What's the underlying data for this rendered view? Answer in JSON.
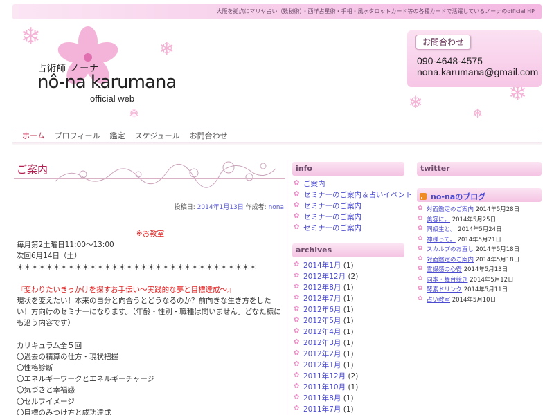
{
  "header": {
    "tagline": "大阪を拠点にマリヤ占い（数秘術）・西洋占星術・手相・風水タロットカード等の各種カードで活躍しているノーナのofficial HP",
    "logo_jp": "占術師 ノーナ",
    "logo_en": "nô-na karumana",
    "logo_sub": "official web"
  },
  "contact": {
    "button_label": "お問合わせ",
    "phone": "090-4648-4575",
    "email": "nona.karumana@gmail.com"
  },
  "nav": {
    "items": [
      "ホーム",
      "プロフィール",
      "鑑定",
      "スケジュール",
      "お問合わせ"
    ]
  },
  "article": {
    "title": "ご案内",
    "meta_prefix": "投稿日:",
    "meta_date": "2014年1月13日",
    "meta_author_label": "作成者:",
    "meta_author": "nona",
    "heading": "※お教室",
    "schedule_1": "毎月第2土曜日11:00～13:00",
    "schedule_2": "次回6月14日（土）",
    "stars": "＊＊＊＊＊＊＊＊＊＊＊＊＊＊＊＊＊＊＊＊＊＊＊＊＊＊＊＊＊＊＊＊＊",
    "catch": "『変わりたいきっかけを探すお手伝い～実践的な夢と目標達成～』",
    "desc": "現状を変えたい！本来の自分と向合うとどうなるのか？前向きな生き方をしたい！方向けのセミナーになります。（年齢・性別・職種は問いません。どなた様にも沿う内容です）",
    "curriculum_title": "カリキュラム全５回",
    "curriculum": [
      "〇過去の精算の仕方・現状把握",
      "〇性格診断",
      "〇エネルギーワークとエネルギーチャージ",
      "〇気づきと幸福感",
      "〇セルフイメージ",
      "〇目標のみつけ方と成功達成"
    ]
  },
  "info": {
    "title": "info",
    "items": [
      "ご案内",
      "セミナーのご案内＆占いイベント",
      "セミナーのご案内",
      "セミナーのご案内",
      "セミナーのご案内"
    ]
  },
  "archives": {
    "title": "archives",
    "items": [
      {
        "label": "2014年1月",
        "count": "(1)"
      },
      {
        "label": "2012年12月",
        "count": "(2)"
      },
      {
        "label": "2012年8月",
        "count": "(1)"
      },
      {
        "label": "2012年7月",
        "count": "(1)"
      },
      {
        "label": "2012年6月",
        "count": "(1)"
      },
      {
        "label": "2012年5月",
        "count": "(1)"
      },
      {
        "label": "2012年4月",
        "count": "(1)"
      },
      {
        "label": "2012年3月",
        "count": "(1)"
      },
      {
        "label": "2012年2月",
        "count": "(1)"
      },
      {
        "label": "2012年1月",
        "count": "(1)"
      },
      {
        "label": "2011年12月",
        "count": "(2)"
      },
      {
        "label": "2011年10月",
        "count": "(1)"
      },
      {
        "label": "2011年8月",
        "count": "(1)"
      },
      {
        "label": "2011年7月",
        "count": "(1)"
      }
    ]
  },
  "twitter": {
    "title": "twitter"
  },
  "blog": {
    "title": "no-naのブログ",
    "items": [
      {
        "label": "対面鑑定のご案内",
        "date": "2014年5月28日"
      },
      {
        "label": "美容に。",
        "date": "2014年5月25日"
      },
      {
        "label": "同級生と。",
        "date": "2014年5月24日"
      },
      {
        "label": "神様って。",
        "date": "2014年5月21日"
      },
      {
        "label": "スカルプのお直し",
        "date": "2014年5月18日"
      },
      {
        "label": "対面鑑定のご案内",
        "date": "2014年5月18日"
      },
      {
        "label": "霊媒感の心得",
        "date": "2014年5月13日"
      },
      {
        "label": "同本・舞台競き",
        "date": "2014年5月12日"
      },
      {
        "label": "酵素ドリンク",
        "date": "2014年5月11日"
      },
      {
        "label": "占い教室",
        "date": "2014年5月10日"
      }
    ]
  },
  "colors": {
    "accent": "#b02050",
    "link": "#4b4bd0",
    "widget_bg": "#f4c3e3",
    "bullet": "#ee8ec8"
  },
  "icons": {
    "flower": "flower-logo-icon",
    "snowflake": "snowflake-icon",
    "bullet": "flower-bullet-icon",
    "rss": "rss-icon"
  }
}
